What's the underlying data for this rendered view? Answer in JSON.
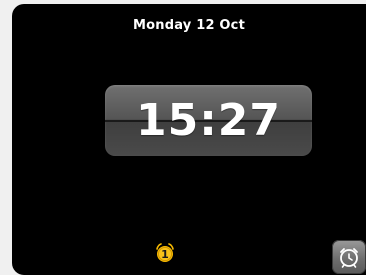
{
  "screen": {
    "date": "Monday 12 Oct",
    "time": "15:27"
  },
  "alarm_indicator": {
    "icon": "alarm-bell-icon",
    "number": "1",
    "color": "#f5b800"
  },
  "alarm_button": {
    "icon": "alarm-clock-icon"
  }
}
